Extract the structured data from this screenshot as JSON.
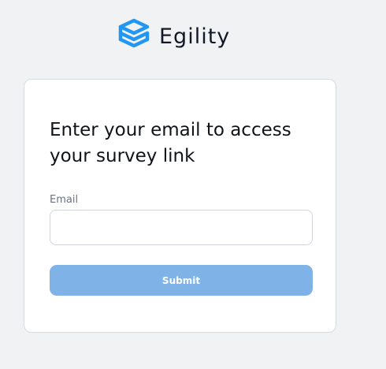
{
  "brand": {
    "name": "Egility",
    "icon": "egility-logo-icon",
    "color": "#2196f3"
  },
  "card": {
    "title": "Enter your email to access your survey link",
    "email_label": "Email",
    "email_value": "",
    "email_placeholder": "",
    "submit_label": "Submit"
  },
  "colors": {
    "background": "#f1f2f4",
    "button": "#7fb3e8",
    "card_border": "#d7dbe0"
  }
}
